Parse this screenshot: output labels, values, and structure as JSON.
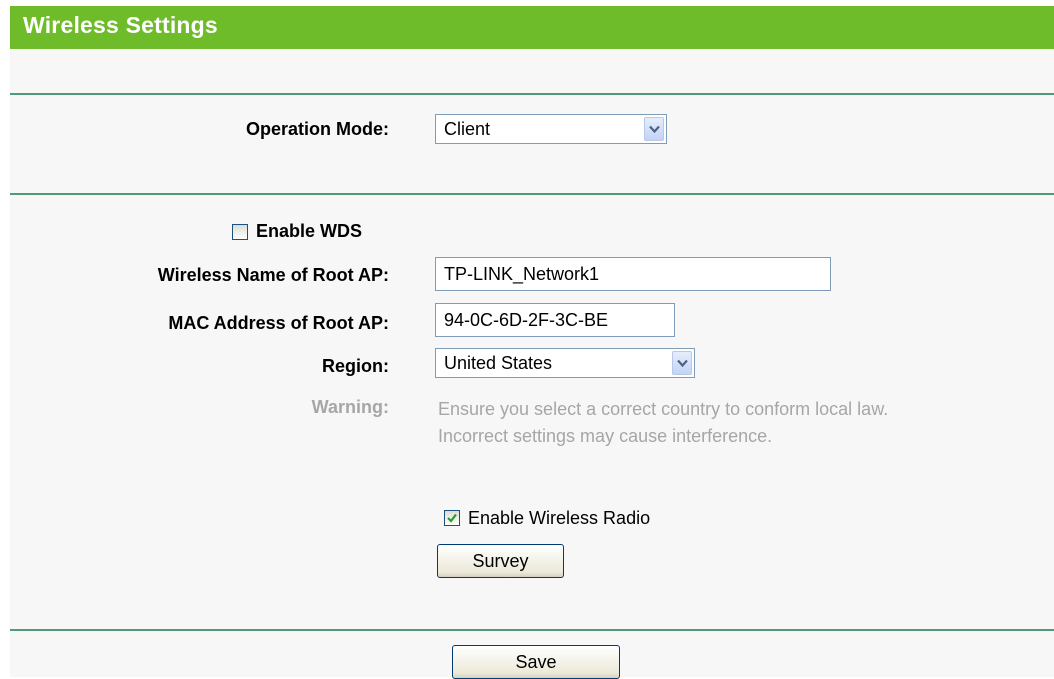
{
  "header": {
    "title": "Wireless Settings"
  },
  "form": {
    "operation_mode": {
      "label": "Operation Mode:",
      "value": "Client"
    },
    "enable_wds": {
      "label": "Enable WDS",
      "checked": false
    },
    "root_ap_name": {
      "label": "Wireless Name of Root AP:",
      "value": "TP-LINK_Network1"
    },
    "root_ap_mac": {
      "label": "MAC Address of Root AP:",
      "value": "94-0C-6D-2F-3C-BE"
    },
    "region": {
      "label": "Region:",
      "value": "United States"
    },
    "warning": {
      "label": "Warning:",
      "line1": "Ensure you select a correct country to conform local law.",
      "line2": "Incorrect settings may cause interference."
    },
    "enable_radio": {
      "label": "Enable Wireless Radio",
      "checked": true
    },
    "survey_label": "Survey"
  },
  "footer": {
    "save_label": "Save"
  },
  "colors": {
    "title_bar": "#6fbc2a",
    "divider": "#4f9a78",
    "panel_bg": "#f7f7f7",
    "warning_text": "#a6a6a6"
  }
}
